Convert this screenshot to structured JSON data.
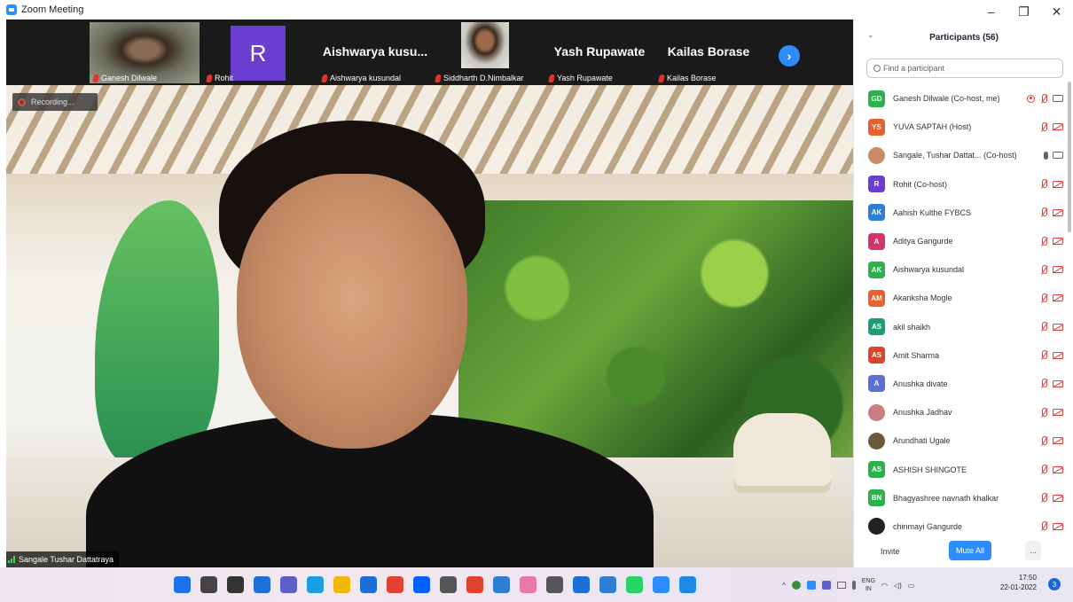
{
  "window": {
    "title": "Zoom Meeting",
    "controls": [
      "–",
      "❐",
      "✕"
    ]
  },
  "thumbnails": [
    {
      "kind": "video",
      "name": "Ganesh Dilwale",
      "muted": true
    },
    {
      "kind": "avatar",
      "initial": "R",
      "name": "Rohit",
      "muted": true
    },
    {
      "kind": "text",
      "display": "Aishwarya kusu...",
      "name": "Aishwarya kusundal",
      "muted": true
    },
    {
      "kind": "video",
      "name": "Siddharth D.Nimbalkar",
      "muted": true
    },
    {
      "kind": "text",
      "display": "Yash Rupawate",
      "name": "Yash Rupawate",
      "muted": true
    },
    {
      "kind": "text",
      "display": "Kailas Borase",
      "name": "Kailas Borase",
      "muted": true
    }
  ],
  "stage": {
    "recording_label": "Recording...",
    "speaker_name": "Sangale Tushar Dattatraya"
  },
  "participants": {
    "title": "Participants (56)",
    "search_placeholder": "Find a participant",
    "list": [
      {
        "initials": "GD",
        "color": "#2bb24c",
        "name": "Ganesh Dilwale (Co-host, me)",
        "status": "recording"
      },
      {
        "initials": "YS",
        "color": "#e8612c",
        "name": "YUVA SAPTAH (Host)",
        "status": "muted"
      },
      {
        "initials": "",
        "color": "#c98a66",
        "name": "Sangale, Tushar Dattat... (Co-host)",
        "status": "talking"
      },
      {
        "initials": "R",
        "color": "#6a3fd0",
        "name": "Rohit (Co-host)",
        "status": "muted"
      },
      {
        "initials": "AK",
        "color": "#2e7fd4",
        "name": "Aahish Kulthe FYBCS",
        "status": "muted"
      },
      {
        "initials": "A",
        "color": "#d6336c",
        "name": "Aditya Gangurde",
        "status": "muted"
      },
      {
        "initials": "AK",
        "color": "#2bb24c",
        "name": "Aishwarya kusundal",
        "status": "muted"
      },
      {
        "initials": "AM",
        "color": "#e8612c",
        "name": "Akanksha Mogle",
        "status": "muted"
      },
      {
        "initials": "AS",
        "color": "#1b9e77",
        "name": "akil shaikh",
        "status": "muted"
      },
      {
        "initials": "AS",
        "color": "#d9452b",
        "name": "Amit Sharma",
        "status": "muted"
      },
      {
        "initials": "A",
        "color": "#5b6fd6",
        "name": "Anushka divate",
        "status": "muted"
      },
      {
        "initials": "",
        "color": "#c77f7f",
        "name": "Anushka Jadhav",
        "status": "muted"
      },
      {
        "initials": "",
        "color": "#6b5a3a",
        "name": "Arundhati Ugale",
        "status": "muted"
      },
      {
        "initials": "AS",
        "color": "#2bb24c",
        "name": "ASHISH SHINGOTE",
        "status": "muted"
      },
      {
        "initials": "BN",
        "color": "#2bb24c",
        "name": "Bhagyashree navnath khalkar",
        "status": "muted"
      },
      {
        "initials": "",
        "color": "#222222",
        "name": "chinmayi Gangurde",
        "status": "muted"
      }
    ],
    "footer": {
      "invite": "Invite",
      "mute_all": "Mute All",
      "more": "..."
    }
  },
  "taskbar": {
    "apps": [
      {
        "icon": "windows-start-icon",
        "color": "#1a73e8"
      },
      {
        "icon": "search-icon",
        "color": "#444444"
      },
      {
        "icon": "task-view-icon",
        "color": "#333333"
      },
      {
        "icon": "widgets-icon",
        "color": "#1e6fd9"
      },
      {
        "icon": "chat-icon",
        "color": "#5b5fc7"
      },
      {
        "icon": "edge-icon",
        "color": "#1b9de2"
      },
      {
        "icon": "file-explorer-icon",
        "color": "#f2b705"
      },
      {
        "icon": "mail-icon",
        "color": "#1b6fd6"
      },
      {
        "icon": "chrome-icon",
        "color": "#e34133"
      },
      {
        "icon": "dropbox-icon",
        "color": "#0061fe"
      },
      {
        "icon": "camera-icon",
        "color": "#555555"
      },
      {
        "icon": "office-icon",
        "color": "#e0432b"
      },
      {
        "icon": "notepad-icon",
        "color": "#2e7fd4"
      },
      {
        "icon": "paint-icon",
        "color": "#e87aa8"
      },
      {
        "icon": "calculator-icon",
        "color": "#555555"
      },
      {
        "icon": "store-icon",
        "color": "#1b6fd6"
      },
      {
        "icon": "monitor-icon",
        "color": "#2e7fd4"
      },
      {
        "icon": "whatsapp-icon",
        "color": "#25d366"
      },
      {
        "icon": "zoom-icon",
        "color": "#2d8cff"
      },
      {
        "icon": "network-tool-icon",
        "color": "#1e88e5"
      }
    ],
    "lang_top": "ENG",
    "lang_bottom": "IN",
    "time": "17:50",
    "date": "22-01-2022",
    "notification_count": "3"
  }
}
